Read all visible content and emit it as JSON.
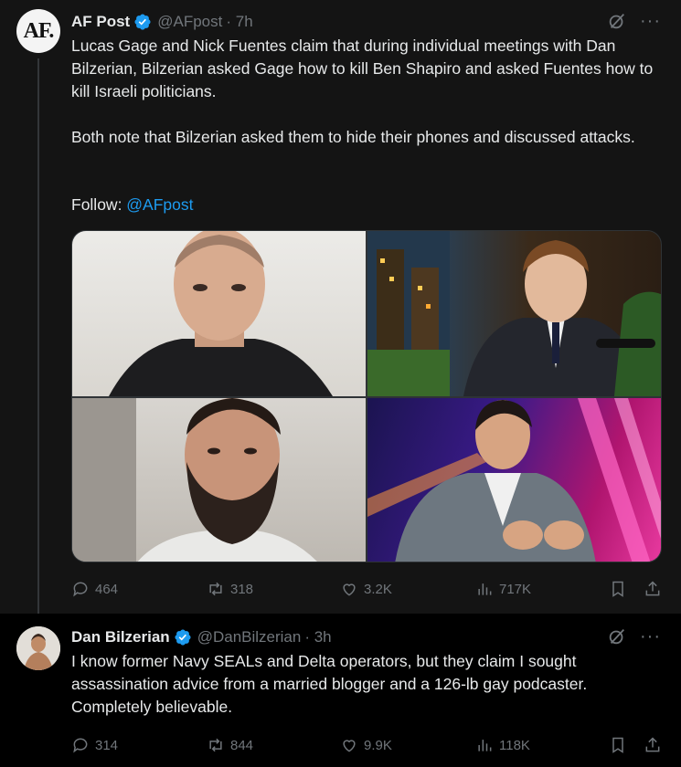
{
  "tweets": [
    {
      "author": {
        "name": "AF Post",
        "handle": "@AFpost",
        "time": "· 7h",
        "avatar_text": "AF.",
        "verified": true
      },
      "paragraphs": [
        "Lucas Gage and Nick Fuentes claim that during individual meetings with Dan Bilzerian, Bilzerian asked Gage how to kill Ben Shapiro and asked Fuentes how to kill Israeli politicians.",
        "Both note that Bilzerian asked them to hide their phones and discussed attacks."
      ],
      "follow_label": "Follow: ",
      "follow_link": "@AFpost",
      "media_count": 4,
      "stats": {
        "replies": "464",
        "retweets": "318",
        "likes": "3.2K",
        "views": "717K"
      }
    },
    {
      "author": {
        "name": "Dan Bilzerian",
        "handle": "@DanBilzerian",
        "time": "· 3h",
        "verified": true
      },
      "text": "I know former Navy SEALs and Delta operators, but they claim I sought assassination advice from a married blogger and a 126-lb gay podcaster. Completely believable.",
      "stats": {
        "replies": "314",
        "retweets": "844",
        "likes": "9.9K",
        "views": "118K"
      }
    }
  ],
  "icons": {
    "verified": "verified-badge-icon",
    "grok": "grok-icon",
    "more": "more-icon",
    "reply": "reply-icon",
    "retweet": "retweet-icon",
    "like": "heart-icon",
    "views": "views-icon",
    "bookmark": "bookmark-icon",
    "share": "share-icon"
  },
  "colors": {
    "accent": "#1d9bf0",
    "muted": "#71767b",
    "text": "#e7e9ea"
  }
}
